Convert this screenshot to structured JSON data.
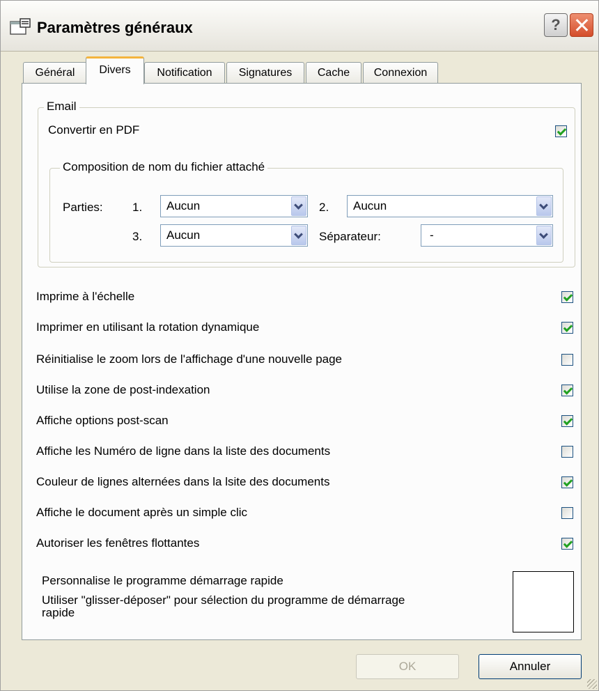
{
  "window": {
    "title": "Paramètres généraux",
    "help_label": "?"
  },
  "tabs": [
    {
      "label": "Général"
    },
    {
      "label": "Divers"
    },
    {
      "label": "Notification"
    },
    {
      "label": "Signatures"
    },
    {
      "label": "Cache"
    },
    {
      "label": "Connexion"
    }
  ],
  "active_tab": "Divers",
  "email": {
    "legend": "Email",
    "convert_pdf_label": "Convertir en PDF",
    "convert_pdf_checked": true,
    "composition": {
      "legend": "Composition de nom du fichier attaché",
      "parts_label": "Parties:",
      "n1": "1.",
      "v1": "Aucun",
      "n2": "2.",
      "v2": "Aucun",
      "n3": "3.",
      "v3": "Aucun",
      "sep_label": "Séparateur:",
      "sep_value": "-"
    }
  },
  "options": [
    {
      "label": "Imprime à l'échelle",
      "checked": true
    },
    {
      "label": "Imprimer en utilisant la rotation dynamique",
      "checked": true
    },
    {
      "label": "Réinitialise le zoom lors de l'affichage d'une nouvelle page",
      "checked": false
    },
    {
      "label": "Utilise la zone de post-indexation",
      "checked": true
    },
    {
      "label": "Affiche options post-scan",
      "checked": true
    },
    {
      "label": "Affiche les Numéro de ligne dans la liste des documents",
      "checked": false
    },
    {
      "label": "Couleur de lignes alternées dans la lsite des documents",
      "checked": true
    },
    {
      "label": "Affiche le document après un simple clic",
      "checked": false
    },
    {
      "label": "Autoriser les fenêtres flottantes",
      "checked": true
    }
  ],
  "quick_launch": {
    "title": "Personnalise  le  programme  démarrage  rapide",
    "desc_line1": "Utiliser  \"glisser-déposer\"  pour  sélection  du  programme  de  démarrage",
    "desc_line2": "rapide"
  },
  "buttons": {
    "ok": "OK",
    "cancel": "Annuler"
  },
  "colors": {
    "tab_highlight": "#f4b43c",
    "check": "#21a121",
    "close_button": "#d44d2b"
  }
}
